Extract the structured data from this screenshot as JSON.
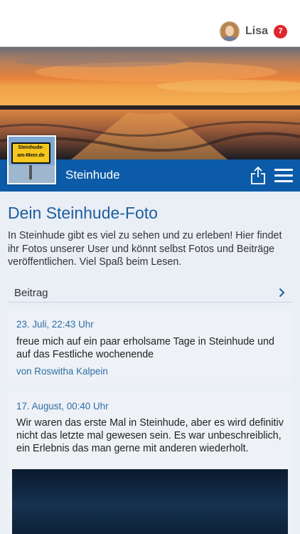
{
  "header": {
    "user_name": "Lisa",
    "notification_count": "7"
  },
  "location_bar": {
    "site_name": "Steinhude",
    "logo_text": [
      "Steinhude-",
      "am-Meer.de"
    ]
  },
  "page": {
    "title": "Dein Steinhude-Foto",
    "intro": "In Steinhude gibt es viel zu sehen und zu erleben! Hier findet ihr Fotos unserer User und könnt selbst Fotos und Beiträge veröffentlichen. Viel Spaß beim Lesen."
  },
  "beitrag": {
    "label": "Beitrag"
  },
  "posts": [
    {
      "date": "23. Juli, 22:43 Uhr",
      "text": "freue mich auf ein paar erholsame Tage in Steinhude und auf das Festliche wochenende",
      "author": "von Roswitha Kalpein"
    },
    {
      "date": "17. August, 00:40 Uhr",
      "text": "Wir waren das erste Mal in Steinhude, aber es wird definitiv nicht das letzte mal gewesen sein. Es war unbeschreiblich, ein Erlebnis das man gerne mit anderen wiederholt."
    }
  ],
  "colors": {
    "accent": "#0c5ba8",
    "link": "#2d6fa8",
    "badge": "#e0252c",
    "background": "#eaeef5"
  },
  "icons": [
    "avatar",
    "share-icon",
    "menu-icon",
    "chevron-right-icon"
  ]
}
